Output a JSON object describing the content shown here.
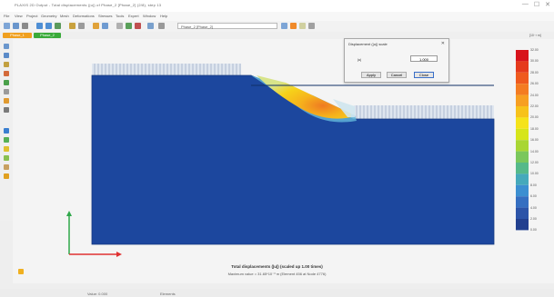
{
  "window": {
    "title": "PLAXIS 2D Output - Total displacements (|u|) of Phase_2 [Phase_2] (2/8), step 13",
    "controls": [
      "—",
      "☐",
      "✕"
    ]
  },
  "menu": [
    "File",
    "View",
    "Project",
    "Geometry",
    "Mesh",
    "Deformations",
    "Stresses",
    "Tools",
    "Expert",
    "Window",
    "Help"
  ],
  "toolbar": {
    "combo_value": "Phase_2 [Phase_2]",
    "buttons": [
      "open",
      "save",
      "print",
      "zoom-in",
      "zoom-out",
      "reset-view",
      "move",
      "select",
      "draw-cross-section",
      "table"
    ]
  },
  "tabs": [
    {
      "label": "Phase_1",
      "color": "#f0a020"
    },
    {
      "label": "Phase_2",
      "color": "#3aaa3a"
    }
  ],
  "dialog": {
    "title": "Displacement (|u|) scale",
    "label": "|u|",
    "value": "1.000",
    "buttons": [
      "Apply",
      "Cancel",
      "Close"
    ]
  },
  "legend": {
    "unit": "[10⁻³ m]",
    "values": [
      "32.00",
      "30.00",
      "28.00",
      "26.00",
      "24.00",
      "22.00",
      "20.00",
      "18.00",
      "16.00",
      "14.00",
      "12.00",
      "10.00",
      "8.00",
      "6.00",
      "4.00",
      "2.00",
      "0.00"
    ],
    "colors": [
      "#d8141c",
      "#e53a1c",
      "#ef5a1e",
      "#f47c22",
      "#f79f22",
      "#f7c21b",
      "#f5e31a",
      "#d6e51a",
      "#a9d634",
      "#7ac75c",
      "#55b98a",
      "#45a9bb",
      "#3c8fd1",
      "#356fc1",
      "#2c54a8",
      "#22408f",
      "#1b3580"
    ]
  },
  "captions": {
    "line1": "Total displacements (|u|) (scaled up 1.00 times)",
    "line2": "Maximum value = 31.65*10⁻³ m (Element 456 at Node 4776)"
  },
  "status": {
    "left": "Value: 0.000",
    "mid": "Elements"
  },
  "colors": {
    "soil": "#1c479e",
    "soil_edge": "#16397f",
    "slide": "#f6d21a",
    "slide_core": "#ef7a22"
  }
}
